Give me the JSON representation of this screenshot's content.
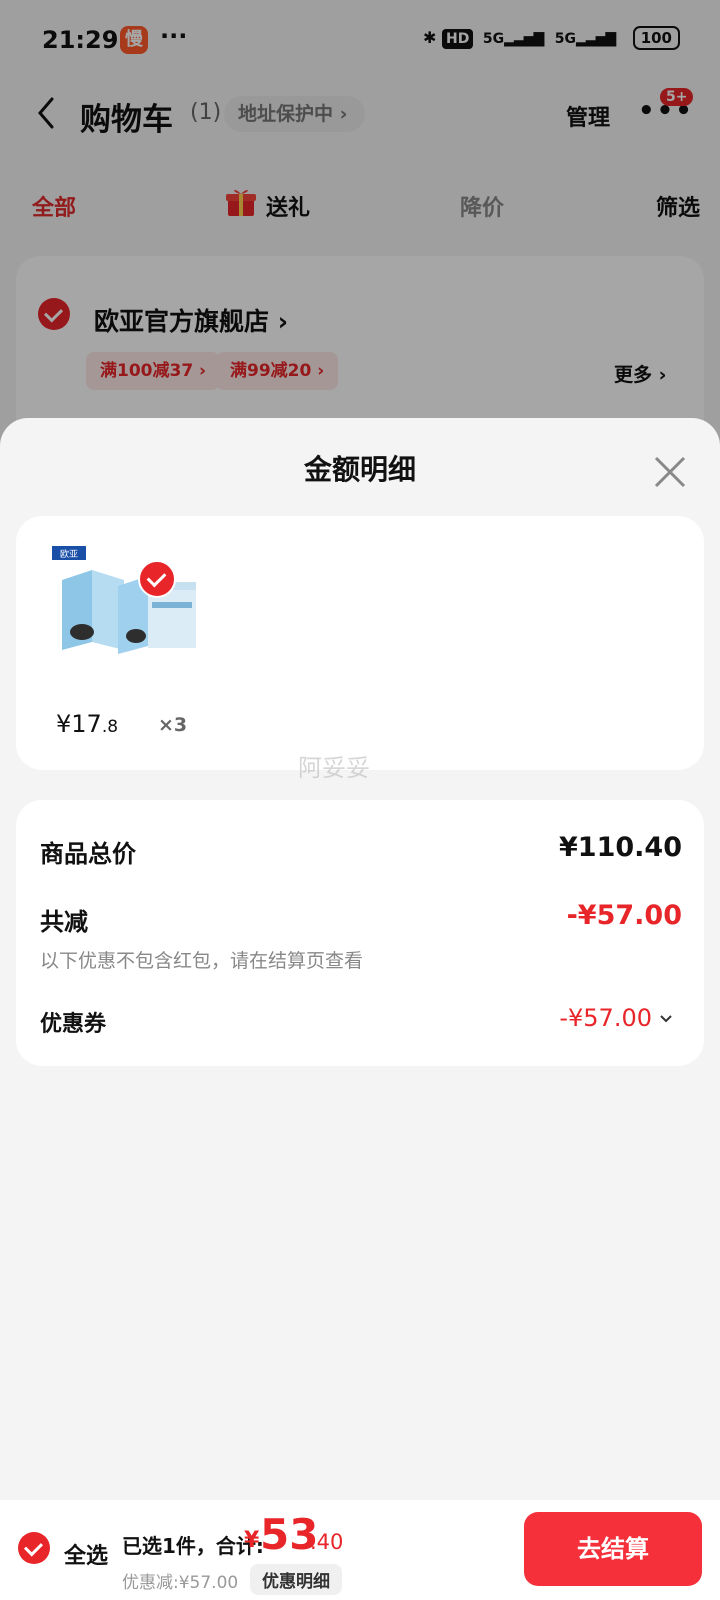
{
  "status_bar": {
    "time": "21:29",
    "app_badge": "慢",
    "dots": "···",
    "hd": "HD",
    "sig1": "5G",
    "sig2": "5G",
    "battery": "100"
  },
  "header": {
    "title": "购物车",
    "count": "(1)",
    "address_pill": "地址保护中 ›",
    "manage": "管理",
    "more_badge": "5+"
  },
  "tabs": {
    "all": "全部",
    "gift": "送礼",
    "price_drop": "降价",
    "filter": "筛选"
  },
  "store": {
    "name": "欧亚官方旗舰店 ›",
    "coupons": [
      "满100减37 ›",
      "满99减20 ›"
    ],
    "more": "更多 ›"
  },
  "sheet": {
    "title": "金额明细",
    "product": {
      "price_int": "¥17",
      "price_dec": ".8",
      "qty": "×3",
      "brand": "欧亚"
    },
    "watermark": "阿妥妥",
    "summary": {
      "total_label": "商品总价",
      "total_value": "¥110.40",
      "reduce_label": "共减",
      "reduce_value": "-¥57.00",
      "note": "以下优惠不包含红包，请在结算页查看",
      "coupon_label": "优惠券",
      "coupon_value": "-¥57.00"
    }
  },
  "bottom_bar": {
    "select_all": "全选",
    "selected": "已选1件，合计:",
    "currency": "¥",
    "total_int": "53",
    "total_dec": ".40",
    "discount": "优惠减:¥57.00",
    "detail_button": "优惠明细",
    "checkout": "去结算"
  },
  "colors": {
    "accent_red": "#e8262a",
    "checkout_red": "#f5303a"
  }
}
